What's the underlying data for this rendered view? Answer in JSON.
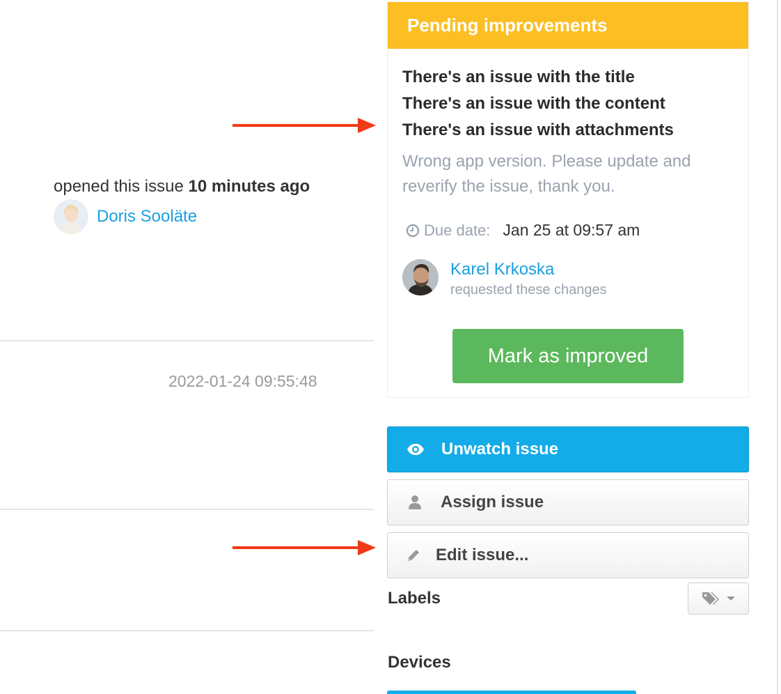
{
  "issue_meta": {
    "opened_prefix": "opened this issue",
    "opened_time": "10 minutes ago",
    "author_name": "Doris Sooläte",
    "timestamp": "2022-01-24 09:55:48"
  },
  "pending": {
    "header": "Pending improvements",
    "issues": [
      "There's an issue with the title",
      "There's an issue with the content",
      "There's an issue with attachments"
    ],
    "note": "Wrong app version. Please update and reverify the issue, thank you.",
    "due_label": "Due date:",
    "due_value": "Jan 25 at 09:57 am",
    "requester_name": "Karel Krkoska",
    "requester_sub": "requested these changes",
    "mark_button": "Mark as improved",
    "header_color": "#fbbf24",
    "button_color": "#5cb85c"
  },
  "actions": {
    "unwatch": "Unwatch issue",
    "assign": "Assign issue",
    "edit": "Edit issue...",
    "unwatch_icon": "eye-icon",
    "assign_icon": "user-icon",
    "edit_icon": "pencil-icon",
    "primary_color": "#13ace9"
  },
  "sidebar": {
    "labels_heading": "Labels",
    "labels_icon": "tag-icon",
    "devices_heading": "Devices"
  },
  "annotations": {
    "arrow_color": "#f03a17"
  }
}
